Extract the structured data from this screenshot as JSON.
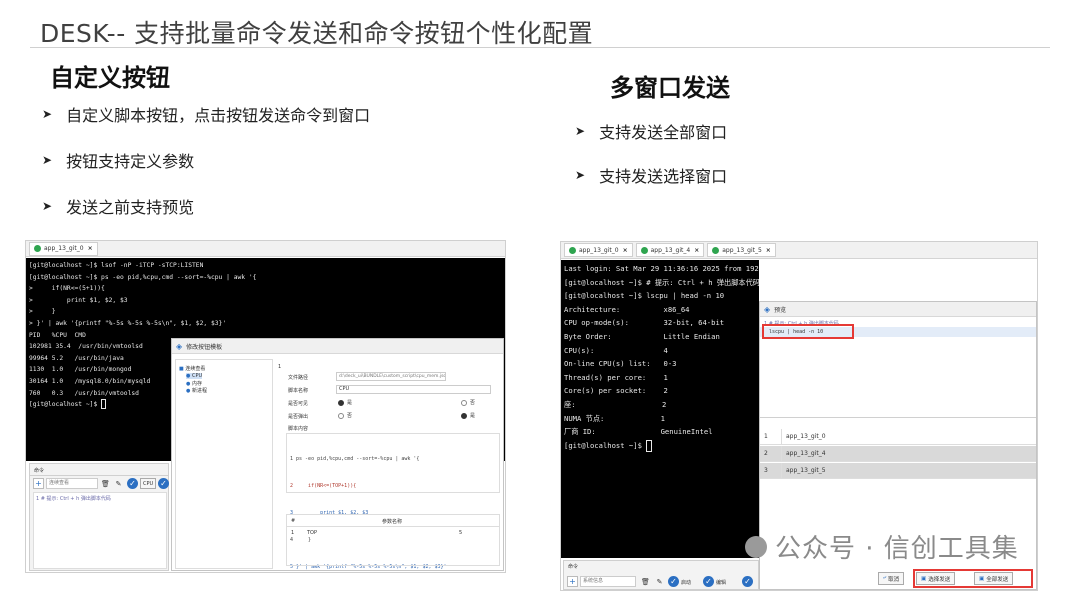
{
  "slide": {
    "title": "DESK-- 支持批量命令发送和命令按钮个性化配置"
  },
  "left_section": {
    "heading": "自定义按钮",
    "bullets": [
      "自定义脚本按钮，点击按钮发送命令到窗口",
      "按钮支持定义参数",
      "发送之前支持预览"
    ]
  },
  "right_section": {
    "heading": "多窗口发送",
    "bullets": [
      "支持发送全部窗口",
      "支持发送选择窗口"
    ]
  },
  "left_shot": {
    "tab": "app_13_git_0",
    "terminal_lines": [
      "[git@localhost ~]$ lsof -nP -iTCP -sTCP:LISTEN",
      "[git@localhost ~]$ ps -eo pid,%cpu,cmd --sort=-%cpu | awk '{",
      ">     if(NR<=(5+1)){",
      ">         print $1, $2, $3",
      ">     }",
      "> }' | awk '{printf \"%-5s %-5s %-5s\\n\", $1, $2, $3}'",
      "PID   %CPU  CMD",
      "102981 35.4  /usr/bin/vmtoolsd",
      "99964 5.2   /usr/bin/java",
      "1130  1.0   /usr/bin/mongod",
      "30164 1.0   /mysql8.0/bin/mysqld",
      "760   0.3   /usr/bin/vmtoolsd",
      "[git@localhost ~]$ "
    ],
    "cmd_tab": "命令",
    "cmd_input_placeholder": "连续查看",
    "hint_line": "1 # 提示: Ctrl + h 弹出脚本代码",
    "dialog": {
      "title": "修改按钮模板",
      "tree_root": "连续查看",
      "tree_items": [
        "CPU",
        "内存",
        "新进程"
      ],
      "row1_no": "1",
      "form": {
        "file_path_label": "文件路径",
        "file_path_value": "d:\\deck_ui\\BUNDLE\\custom_script\\cpu_mem.json",
        "name_label": "脚本名称",
        "name_value": "CPU",
        "opt1_label": "是否可见",
        "opt1_yes": "是",
        "opt1_no": "否",
        "opt2_label": "是否弹出",
        "opt2_yes": "否",
        "opt2_no": "是",
        "content_label": "脚本内容"
      },
      "code_lines": [
        "1 ps -eo pid,%cpu,cmd --sort=-%cpu | awk '{",
        "2     if(NR<=(TOP+1)){",
        "3         print $1, $2, $3",
        "4     }",
        "5 }' | awk '{printf \"%-5s %-5s %-5s\\n\", $1, $2, $3}'"
      ],
      "param_col1": "#",
      "param_col2": "参数名称",
      "param_row_no": "1",
      "param_row_name": "TOP",
      "param_row_value": "5"
    }
  },
  "right_shot": {
    "tabs": [
      "app_13_git_0",
      "app_13_git_4",
      "app_13_git_5"
    ],
    "terminal_lines": [
      "Last login: Sat Mar 29 11:36:16 2025 from 192.168.23.1",
      "[git@localhost ~]$ # 提示: Ctrl + h 弹出脚本代码",
      "[git@localhost ~]$ lscpu | head -n 10",
      "Architecture:          x86_64",
      "CPU op-mode(s):        32-bit, 64-bit",
      "Byte Order:            Little Endian",
      "CPU(s):                4",
      "On-line CPU(s) list:   0-3",
      "Thread(s) per core:    1",
      "Core(s) per socket:    2",
      "座:                    2",
      "NUMA 节点:             1",
      "厂商 ID:               GenuineIntel",
      "[git@localhost ~]$ "
    ],
    "preview": {
      "title": "预览",
      "hint": "1 # 提示: Ctrl + h 弹出脚本代码",
      "cmd": "lscpu | head -n 10",
      "windows": [
        {
          "n": "1",
          "name": "app_13_git_0"
        },
        {
          "n": "2",
          "name": "app_13_git_4"
        },
        {
          "n": "3",
          "name": "app_13_git_5"
        }
      ],
      "cancel": "取消",
      "send_selected": "选择发送",
      "send_all": "全部发送"
    },
    "cmd_tab": "命令",
    "cmd_input_placeholder": "系统信息",
    "start_label": "启动",
    "edit_label": "编辑"
  },
  "watermark": "公众号 · 信创工具集",
  "colors": {
    "accent_green": "#2ea44f",
    "highlight_red": "#e53935",
    "terminal_bg": "#000000",
    "selection_blue": "#2b6fc2"
  }
}
